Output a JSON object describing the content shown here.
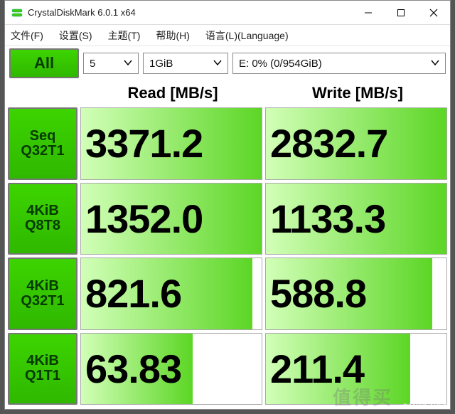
{
  "window": {
    "title": "CrystalDiskMark 6.0.1 x64"
  },
  "menu": {
    "file": "文件(F)",
    "settings": "设置(S)",
    "theme": "主题(T)",
    "help": "帮助(H)",
    "language": "语言(L)(Language)"
  },
  "toolbar": {
    "all_label": "All",
    "runs_value": "5",
    "size_value": "1GiB",
    "drive_value": "E: 0% (0/954GiB)"
  },
  "headers": {
    "read": "Read [MB/s]",
    "write": "Write [MB/s]"
  },
  "tests": [
    {
      "label1": "Seq",
      "label2": "Q32T1",
      "read": "3371.2",
      "write": "2832.7",
      "rfill": 100,
      "wfill": 100
    },
    {
      "label1": "4KiB",
      "label2": "Q8T8",
      "read": "1352.0",
      "write": "1133.3",
      "rfill": 100,
      "wfill": 100
    },
    {
      "label1": "4KiB",
      "label2": "Q32T1",
      "read": "821.6",
      "write": "588.8",
      "rfill": 95,
      "wfill": 92
    },
    {
      "label1": "4KiB",
      "label2": "Q1T1",
      "read": "63.83",
      "write": "211.4",
      "rfill": 62,
      "wfill": 80
    }
  ],
  "watermark": {
    "site": "SMYZ.NET",
    "brand": "值得买"
  }
}
